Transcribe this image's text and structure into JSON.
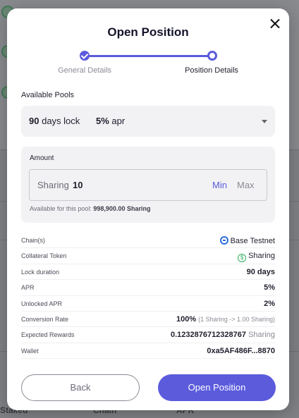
{
  "background": {
    "footer_cols": [
      "Staked",
      "Chain",
      "APR"
    ]
  },
  "modal": {
    "title": "Open Position",
    "steps": [
      {
        "label": "General Details",
        "state": "done"
      },
      {
        "label": "Position Details",
        "state": "current"
      }
    ],
    "pools_label": "Available Pools",
    "pool_select": {
      "lock_value": "90",
      "lock_text": "days lock",
      "apr_value": "5%",
      "apr_text": "apr"
    },
    "amount": {
      "label": "Amount",
      "unit": "Sharing",
      "value": "10",
      "min_label": "Min",
      "max_label": "Max",
      "available_prefix": "Available for this pool:",
      "available_value": "998,900.00 Sharing"
    },
    "details": {
      "chain_label": "Chain(s)",
      "chain_value": "Base Testnet",
      "collateral_label": "Collateral Token",
      "collateral_value": "Sharing",
      "lock_label": "Lock duration",
      "lock_value": "90 days",
      "apr_label": "APR",
      "apr_value": "5%",
      "unlocked_label": "Unlocked APR",
      "unlocked_value": "2%",
      "conversion_label": "Conversion Rate",
      "conversion_value": "100%",
      "conversion_note": "(1 Sharing -> 1.00 Sharing)",
      "rewards_label": "Expected Rewards",
      "rewards_value": "0.1232876712328767",
      "rewards_unit": "Sharing",
      "wallet_label": "Wallet",
      "wallet_value": "0xa5AF486F...8870"
    },
    "back_label": "Back",
    "submit_label": "Open Position"
  },
  "colors": {
    "accent": "#5b5bdc",
    "token_green": "#2fae5e",
    "chain_blue": "#2e6edc"
  },
  "icons": [
    "close-icon",
    "check-icon",
    "chevron-down-icon",
    "base-chain-icon",
    "sharing-token-icon"
  ]
}
